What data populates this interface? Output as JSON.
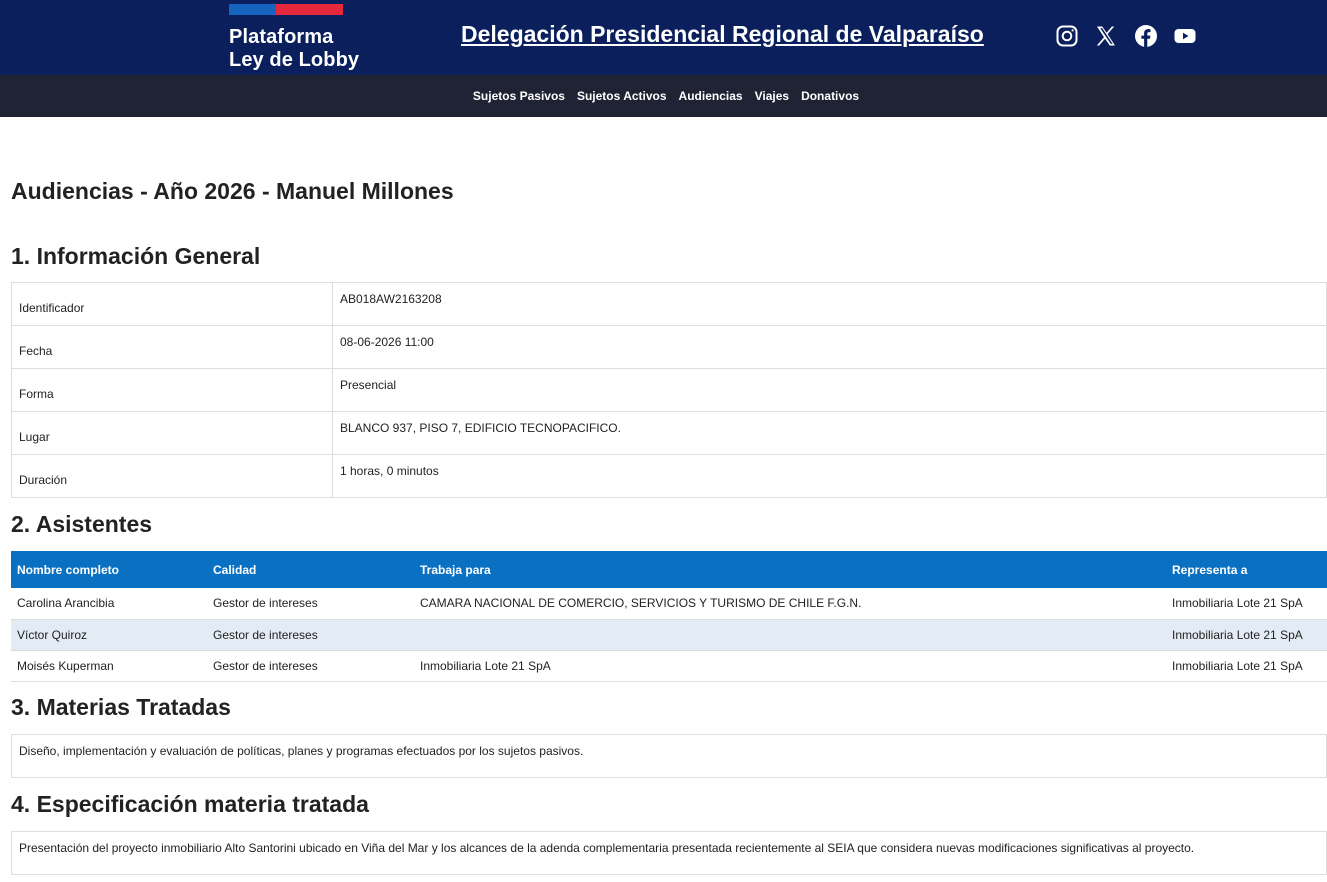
{
  "header": {
    "logo_line1": "Plataforma",
    "logo_line2": "Ley de Lobby",
    "site_title": "Delegación Presidencial Regional de Valparaíso",
    "social": [
      "instagram-icon",
      "x-icon",
      "facebook-icon",
      "youtube-icon"
    ]
  },
  "nav": {
    "items": [
      "Sujetos Pasivos",
      "Sujetos Activos",
      "Audiencias",
      "Viajes",
      "Donativos"
    ]
  },
  "page_title": "Audiencias - Año 2026 - Manuel Millones",
  "sections": {
    "general": {
      "title": "1. Información General",
      "rows": [
        {
          "label": "Identificador",
          "value": "AB018AW2163208"
        },
        {
          "label": "Fecha",
          "value": "08-06-2026 11:00"
        },
        {
          "label": "Forma",
          "value": "Presencial"
        },
        {
          "label": "Lugar",
          "value": "BLANCO 937, PISO 7, EDIFICIO TECNOPACIFICO."
        },
        {
          "label": "Duración",
          "value": "1 horas, 0 minutos"
        }
      ]
    },
    "asistentes": {
      "title": "2. Asistentes",
      "headers": [
        "Nombre completo",
        "Calidad",
        "Trabaja para",
        "Representa a"
      ],
      "rows": [
        [
          "Carolina Arancibia",
          "Gestor de intereses",
          "CAMARA NACIONAL DE COMERCIO, SERVICIOS Y TURISMO DE CHILE F.G.N.",
          "Inmobiliaria Lote 21 SpA"
        ],
        [
          "Víctor Quiroz",
          "Gestor de intereses",
          "",
          "Inmobiliaria Lote 21 SpA"
        ],
        [
          "Moisés Kuperman",
          "Gestor de intereses",
          "Inmobiliaria Lote 21 SpA",
          "Inmobiliaria Lote 21 SpA"
        ]
      ]
    },
    "materias": {
      "title": "3. Materias Tratadas",
      "text": "Diseño, implementación y evaluación de políticas, planes y programas efectuados por los sujetos pasivos."
    },
    "especificacion": {
      "title": "4. Especificación materia tratada",
      "text": "Presentación del proyecto inmobiliario Alto Santorini ubicado en Viña del Mar y los alcances de la adenda complementaria presentada recientemente al SEIA que considera nuevas modificaciones significativas al proyecto."
    }
  },
  "colors": {
    "header_bg": "#0a1f5c",
    "nav_bg": "#1f2333",
    "table_header_bg": "#0a71c2",
    "row_alt_bg": "#e3ecf5",
    "logo_blue": "#1565c0",
    "logo_red": "#e6283c"
  }
}
